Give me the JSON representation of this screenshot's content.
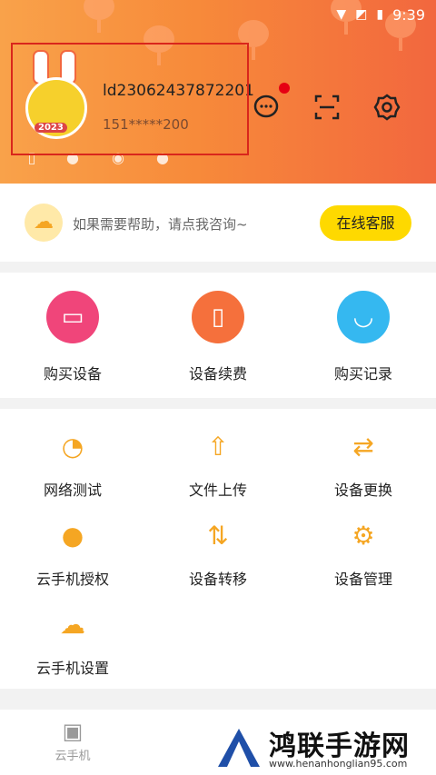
{
  "status_bar": {
    "time": "9:39",
    "wifi_icon": "wifi-icon",
    "sim_icon": "no-sim-icon",
    "battery_icon": "battery-icon"
  },
  "header": {
    "user_id": "ld23062437872201",
    "phone": "151*****200",
    "avatar_year": "2023",
    "actions": [
      {
        "name": "message-icon",
        "has_badge": true
      },
      {
        "name": "scan-icon"
      },
      {
        "name": "settings-icon"
      }
    ],
    "mini_icons": [
      "phone-icon",
      "person-icon",
      "chat-icon",
      "profile-icon"
    ],
    "colors": {
      "gradient_start": "#f9a24a",
      "gradient_end": "#f2673e",
      "badge": "#e60012"
    }
  },
  "help": {
    "text": "如果需要帮助，请点我咨询~",
    "button": "在线客服",
    "button_color": "#fed900"
  },
  "buy_section": [
    {
      "label": "购买设备",
      "icon": "card-icon",
      "color": "#f0457a"
    },
    {
      "label": "设备续费",
      "icon": "phone-icon",
      "color": "#f5703c"
    },
    {
      "label": "购买记录",
      "icon": "bag-icon",
      "color": "#35b8f0"
    }
  ],
  "tools": [
    {
      "label": "网络测试",
      "icon": "speedometer-icon"
    },
    {
      "label": "文件上传",
      "icon": "upload-folder-icon"
    },
    {
      "label": "设备更换",
      "icon": "swap-icon"
    },
    {
      "label": "云手机授权",
      "icon": "user-check-icon"
    },
    {
      "label": "设备转移",
      "icon": "transfer-icon"
    },
    {
      "label": "设备管理",
      "icon": "monitor-gear-icon"
    },
    {
      "label": "云手机设置",
      "icon": "cloud-gear-icon"
    }
  ],
  "tabs": [
    {
      "label": "云手机",
      "icon": "cloud-phone-icon"
    }
  ],
  "watermark": {
    "title": "鸿联手游网",
    "url": "www.henanhonglian95.com"
  }
}
